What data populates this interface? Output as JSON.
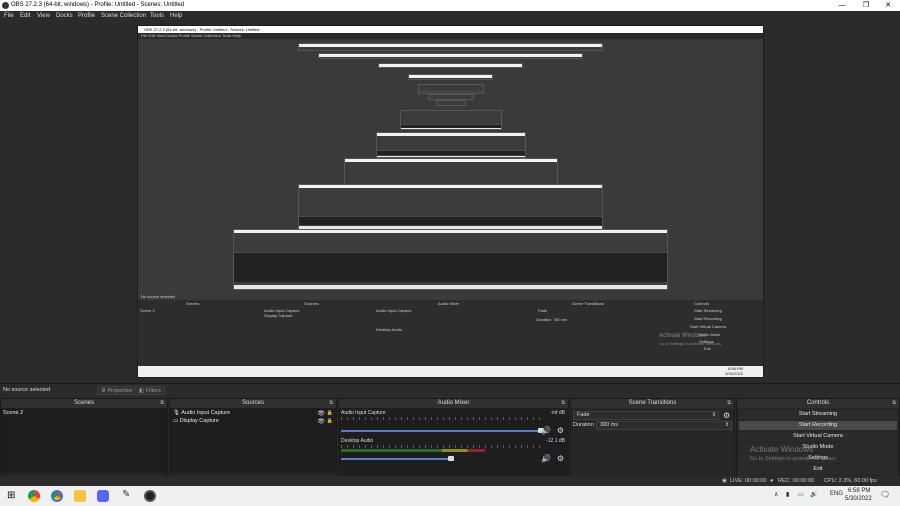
{
  "window": {
    "title": "OBS 27.2.3 (64-bit, windows) - Profile: Untitled - Scenes: Untitled",
    "minimize": "—",
    "maximize": "❐",
    "close": "✕"
  },
  "menu": [
    "File",
    "Edit",
    "View",
    "Docks",
    "Profile",
    "Scene Collection",
    "Tools",
    "Help"
  ],
  "nested_preview": {
    "title": "OBS 27.2.3 (64-bit, windows) - Profile: Untitled - Scenes: Untitled",
    "menu": "File  Edit  View  Docks  Profile  Scene Collection  Tools  Help",
    "no_source": "No source selected",
    "docks": [
      "Scenes",
      "Sources",
      "Audio Mixer",
      "Scene Transitions",
      "Controls"
    ],
    "scene": "Scene 2",
    "sources": [
      "Audio Input Capture",
      "Display Capture"
    ],
    "mixer": [
      "Audio Input Capture",
      "Desktop Audio"
    ],
    "transition": "Fade",
    "duration_label": "Duration",
    "duration_value": "300 ms",
    "controls": [
      "Start Streaming",
      "Start Recording",
      "Start Virtual Camera",
      "Studio Mode",
      "Settings",
      "Exit"
    ],
    "watermark": "Activate Windows",
    "watermark_sub": "Go to Settings to activate Windows.",
    "clock": "6:58 PM",
    "date": "5/30/2022"
  },
  "source_toolbar": {
    "no_source": "No source selected",
    "properties": "Properties",
    "filters": "Filters"
  },
  "scenes": {
    "header": "Scenes",
    "items": [
      "Scene 2"
    ],
    "footer": [
      "+",
      "−",
      "∧",
      "∨"
    ]
  },
  "sources": {
    "header": "Sources",
    "items": [
      "Audio Input Capture",
      "Display Capture"
    ],
    "footer": [
      "+",
      "−",
      "⚙",
      "∧",
      "∨"
    ]
  },
  "mixer": {
    "header": "Audio Mixer",
    "channels": [
      {
        "name": "Audio Input Capture",
        "db": "-inf dB",
        "level": 0.0,
        "volume": 1.0
      },
      {
        "name": "Desktop Audio",
        "db": "-12.1 dB",
        "level": 0.72,
        "volume": 0.55
      }
    ]
  },
  "transitions": {
    "header": "Scene Transitions",
    "selected": "Fade",
    "duration_label": "Duration",
    "duration_value": "300 ms"
  },
  "controls": {
    "header": "Controls",
    "buttons": [
      "Start Streaming",
      "Start Recording",
      "Start Virtual Camera",
      "Studio Mode",
      "Settings",
      "Exit"
    ],
    "highlighted": 1
  },
  "watermark": {
    "title": "Activate Windows",
    "sub": "Go to Settings to activate Windows."
  },
  "status": {
    "live": "LIVE: 00:00:00",
    "rec": "REC: 00:00:00",
    "cpu": "CPU: 2.3%, 60.00 fps"
  },
  "taskbar": {
    "lang": "ENG",
    "time": "6:58 PM",
    "date": "5/30/2022"
  },
  "colors": {
    "panel_bg": "#272727",
    "dock_bg": "#1e1e1e",
    "accent_slider": "#5a7fc0",
    "meter_green": "#2f6b2f"
  }
}
